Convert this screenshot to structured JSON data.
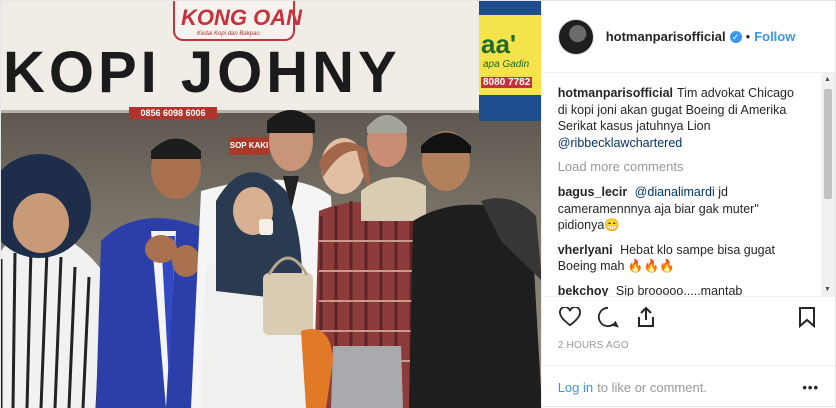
{
  "photo": {
    "banner_text": "KOPI JOHNY",
    "logo_text": "KONG OAN",
    "logo_subtext": "Kedai Kopi dan Bakpao",
    "shop_sign_big": "aa'",
    "shop_sign_small": "apa Gadin",
    "shop_sign_phone": "8080 7782",
    "red_sign": "0856 6098 6006",
    "sop_sign": "SOP KAKI"
  },
  "header": {
    "username": "hotmanparisofficial",
    "verified_icon": "check",
    "separator": "•",
    "follow_label": "Follow"
  },
  "comments": {
    "caption_user": "hotmanparisofficial",
    "caption_text": "Tim advokat Chicago di kopi joni akan gugat Boeing di Amerika Serikat kasus jatuhnya Lion",
    "caption_mention": "@ribbecklawchartered",
    "load_more": "Load more comments",
    "items": [
      {
        "user": "bagus_lecir",
        "mention": "@dianalimardi",
        "text": "jd cameramennnya aja biar gak muter\" pidionya😁"
      },
      {
        "user": "vherlyani",
        "mention": "",
        "text": "Hebat klo sampe bisa gugat Boeing mah 🔥🔥🔥"
      },
      {
        "user": "bekchoy",
        "mention": "",
        "text": "Sip brooooo.....mantab"
      }
    ]
  },
  "actions": {
    "like_icon": "heart-outline",
    "comment_icon": "speech-bubble",
    "share_icon": "share-arrow",
    "save_icon": "bookmark"
  },
  "timestamp": "2 HOURS AGO",
  "footer": {
    "login_link": "Log in",
    "login_text": "to like or comment.",
    "options": "•••"
  }
}
